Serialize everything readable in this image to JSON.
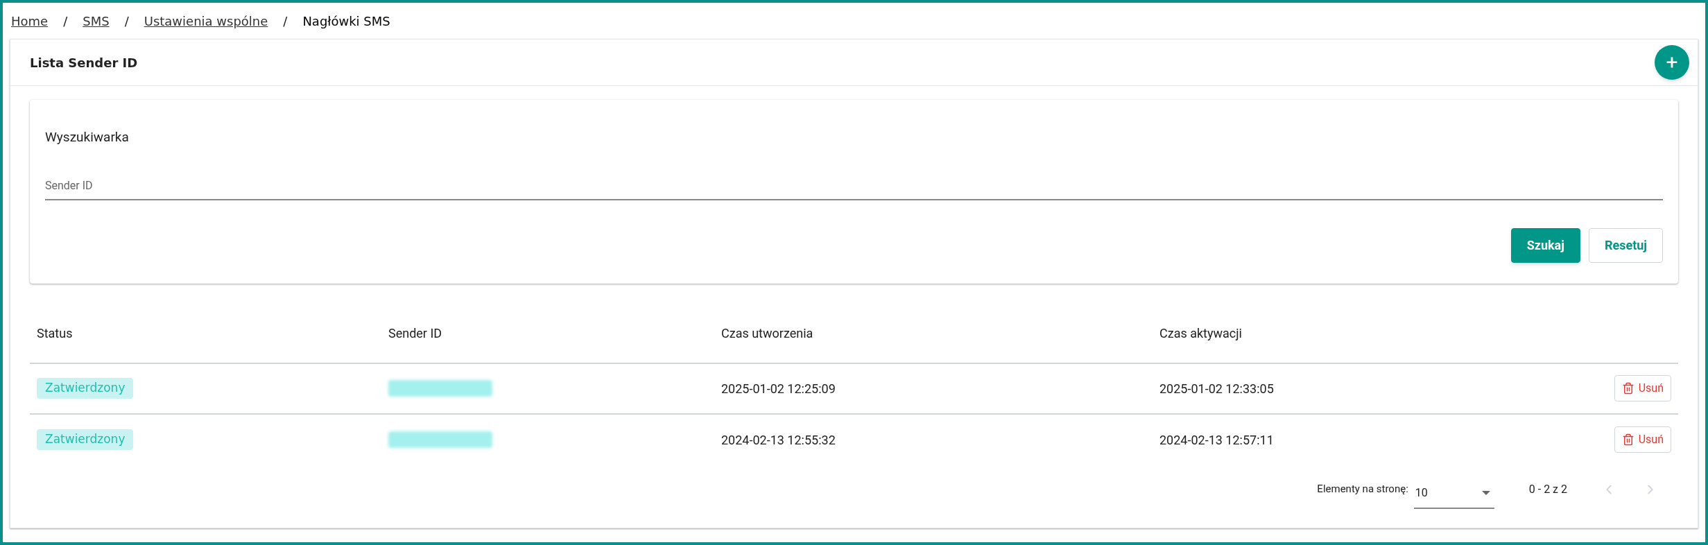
{
  "breadcrumb": [
    {
      "label": "Home",
      "kind": "link"
    },
    {
      "label": "SMS",
      "kind": "link"
    },
    {
      "label": "Ustawienia wspólne",
      "kind": "link"
    },
    {
      "label": "Nagłówki SMS",
      "kind": "current"
    }
  ],
  "breadcrumb_separator": "/",
  "panel": {
    "title": "Lista Sender ID",
    "add_button": "+"
  },
  "search": {
    "title": "Wyszukiwarka",
    "field": {
      "placeholder": "Sender ID"
    },
    "buttons": [
      {
        "label": "Szukaj",
        "kind": "primary"
      },
      {
        "label": "Resetuj",
        "kind": "outline"
      }
    ]
  },
  "table": {
    "columns": [
      "Status",
      "Sender ID",
      "Czas utworzenia",
      "Czas aktywacji"
    ],
    "rows": [
      {
        "status": "Zatwierdzony",
        "sender_id": {
          "kind": "redacted"
        },
        "created": "2025-01-02 12:25:09",
        "activated": "2025-01-02 12:33:05",
        "action": "Usuń"
      },
      {
        "status": "Zatwierdzony",
        "sender_id": {
          "kind": "redacted"
        },
        "created": "2024-02-13 12:55:32",
        "activated": "2024-02-13 12:57:11",
        "action": "Usuń"
      }
    ]
  },
  "pagination": {
    "label": "Elementy na stronę:",
    "page_size": "10",
    "range": "0 - 2 z 2",
    "prev_disabled": true,
    "next_disabled": true
  }
}
